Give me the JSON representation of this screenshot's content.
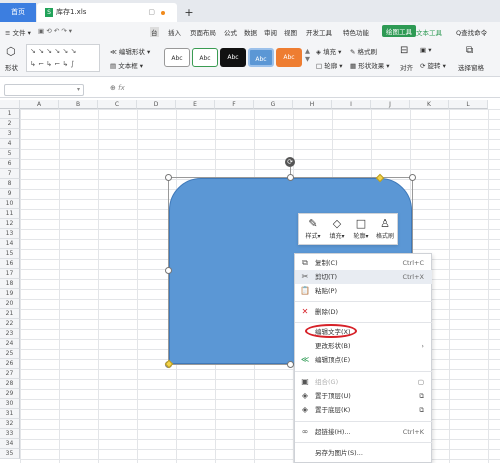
{
  "titlebar": {
    "home_tab": "首页",
    "file_tab": "库存1.xls",
    "new_tab": "+"
  },
  "menubar": {
    "items": [
      "≡ 文件 ▾",
      "台",
      "插入",
      "页面布局",
      "公式",
      "数据",
      "审阅",
      "视图",
      "开发工具",
      "特色功能"
    ],
    "active_tool": "绘图工具",
    "text_tool": "文本工具",
    "search": "Q查找命令"
  },
  "ribbon": {
    "shape_label": "形状",
    "edit_shape": "编辑形状",
    "text_box": "文本框",
    "style_samples": [
      "Abc",
      "Abc",
      "Abc",
      "Abc",
      "Abc"
    ],
    "style_colors": [
      "#ffffff",
      "#ffffff",
      "#111111",
      "#5b97d5",
      "#ee7d31"
    ],
    "fill": "填充",
    "outline": "轮廓",
    "format_brush": "格式刷",
    "shape_effect": "形状效果",
    "align": "对齐",
    "rotate": "旋转",
    "selection_pane": "选择窗格"
  },
  "formula": {
    "fx": "fx"
  },
  "grid": {
    "columns": [
      "A",
      "B",
      "C",
      "D",
      "E",
      "F",
      "G",
      "H",
      "I",
      "J",
      "K",
      "L"
    ],
    "rows": [
      "1",
      "2",
      "3",
      "4",
      "5",
      "6",
      "7",
      "8",
      "9",
      "10",
      "11",
      "12",
      "13",
      "14",
      "15",
      "16",
      "17",
      "18",
      "19",
      "20",
      "21",
      "22",
      "23",
      "24",
      "25",
      "26",
      "27",
      "28",
      "29",
      "30",
      "31",
      "32",
      "33",
      "34",
      "35"
    ]
  },
  "minitool": {
    "style": "样式",
    "fill": "填充",
    "outline": "轮廓",
    "format_brush": "格式刷"
  },
  "context_menu": {
    "copy": {
      "label": "复制(C)",
      "shortcut": "Ctrl+C"
    },
    "cut": {
      "label": "剪切(T)",
      "shortcut": "Ctrl+X"
    },
    "paste": {
      "label": "粘贴(P)"
    },
    "delete": {
      "label": "删除(D)"
    },
    "edit_text": {
      "label": "编辑文字(X)"
    },
    "change_shape": {
      "label": "更改形状(B)"
    },
    "edit_points": {
      "label": "编辑顶点(E)"
    },
    "combine": {
      "label": "组合(G)"
    },
    "bring_front": {
      "label": "置于顶层(U)"
    },
    "send_back": {
      "label": "置于底层(K)"
    },
    "hyperlink": {
      "label": "超链接(H)...",
      "shortcut": "Ctrl+K"
    },
    "save_as_picture": {
      "label": "另存为图片(S)..."
    }
  }
}
